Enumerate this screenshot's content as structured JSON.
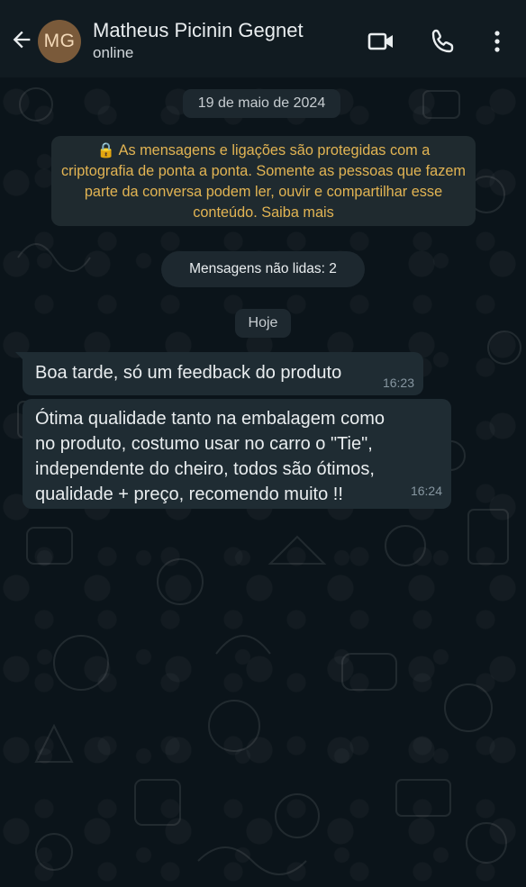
{
  "header": {
    "back_icon": "arrow-left-icon",
    "avatar_initials": "MG",
    "contact_name": "Matheus Picinin Gegnet",
    "status": "online",
    "icons": [
      "video-call-icon",
      "voice-call-icon",
      "more-vert-icon"
    ]
  },
  "chat": {
    "date_label": "19 de maio de 2024",
    "encryption_notice": "🔒 As mensagens e ligações são protegidas com a criptografia de ponta a ponta. Somente as pessoas que fazem parte da conversa podem ler, ouvir e compartilhar esse conteúdo. Saiba mais",
    "unread_label": "Mensagens não lidas: 2",
    "today_label": "Hoje",
    "messages": [
      {
        "text": "Boa tarde, só um feedback do produto",
        "time": "16:23"
      },
      {
        "text": "Ótima qualidade tanto na embalagem como\nno produto, costumo usar no carro o \"Tie\",\nindependente do cheiro, todos são ótimos,\nqualidade + preço, recomendo muito !!",
        "time": "16:24"
      }
    ]
  },
  "colors": {
    "header_bg": "#111b21",
    "chat_bg": "#0b141a",
    "bubble_bg": "#1f2c33",
    "encryption_text": "#e2b453",
    "avatar_bg": "#7a5a3a"
  }
}
